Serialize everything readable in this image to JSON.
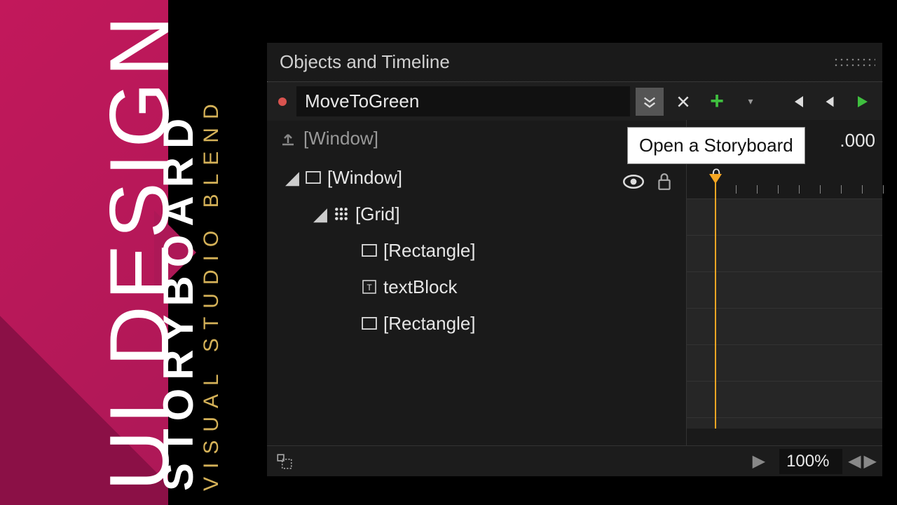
{
  "banner": {
    "line1": "UI DESIGN",
    "line2": "STORYBOARD",
    "line3": "VISUAL STUDIO BLEND"
  },
  "panel": {
    "title": "Objects and Timeline",
    "storyboard_name": "MoveToGreen",
    "tooltip": "Open a Storyboard",
    "scope_label": "[Window]",
    "time_display": ".000",
    "ruler_zero": "0",
    "zoom": "100%"
  },
  "tree": [
    {
      "indent": 0,
      "expanded": true,
      "icon": "window",
      "label": "[Window]",
      "vis": false
    },
    {
      "indent": 1,
      "expanded": true,
      "icon": "grid",
      "label": "[Grid]",
      "vis": true
    },
    {
      "indent": 2,
      "expanded": false,
      "icon": "rect",
      "label": "[Rectangle]",
      "vis": true
    },
    {
      "indent": 2,
      "expanded": false,
      "icon": "textblock",
      "label": "textBlock",
      "vis": true
    },
    {
      "indent": 2,
      "expanded": false,
      "icon": "rect",
      "label": "[Rectangle]",
      "vis": true
    }
  ],
  "icons": {
    "chevrons_down": "⌄",
    "close": "✕",
    "plus": "+",
    "caret": "▾",
    "skip_back": "skip-back",
    "step_back": "step-back",
    "play": "play",
    "upload": "upload",
    "eye": "eye",
    "lock": "lock",
    "keyframe": "○"
  }
}
